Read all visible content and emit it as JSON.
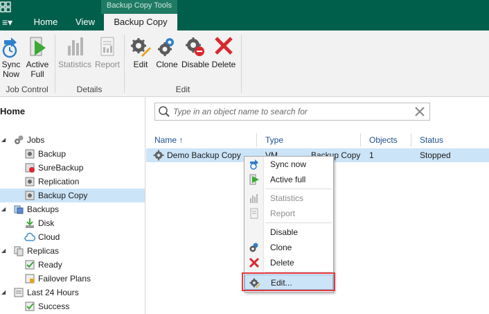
{
  "titlebar": {
    "context_group": "Backup Copy Tools"
  },
  "tabs": {
    "menu": "≡▾",
    "home": "Home",
    "view": "View",
    "backup_copy": "Backup Copy"
  },
  "ribbon": {
    "groups": {
      "job_control": "Job Control",
      "details": "Details",
      "edit": "Edit"
    },
    "buttons": {
      "sync_now": [
        "Sync",
        "Now"
      ],
      "active_full": [
        "Active",
        "Full"
      ],
      "statistics": "Statistics",
      "report": "Report",
      "edit": "Edit",
      "clone": "Clone",
      "disable": "Disable",
      "delete": "Delete"
    }
  },
  "nav": {
    "title": "Home",
    "items": [
      {
        "label": "Jobs",
        "level": 0,
        "icon": "jobs-gear-icon"
      },
      {
        "label": "Backup",
        "level": 1,
        "icon": "backup-job-icon"
      },
      {
        "label": "SureBackup",
        "level": 1,
        "icon": "surebackup-icon"
      },
      {
        "label": "Replication",
        "level": 1,
        "icon": "replication-icon"
      },
      {
        "label": "Backup Copy",
        "level": 1,
        "icon": "backup-copy-icon",
        "selected": true
      },
      {
        "label": "Backups",
        "level": 0,
        "icon": "backups-icon"
      },
      {
        "label": "Disk",
        "level": 1,
        "icon": "disk-icon"
      },
      {
        "label": "Cloud",
        "level": 1,
        "icon": "cloud-icon"
      },
      {
        "label": "Replicas",
        "level": 0,
        "icon": "replicas-icon"
      },
      {
        "label": "Ready",
        "level": 1,
        "icon": "ready-icon"
      },
      {
        "label": "Failover Plans",
        "level": 1,
        "icon": "failover-plans-icon"
      },
      {
        "label": "Last 24 Hours",
        "level": 0,
        "icon": "last-24-hours-icon"
      },
      {
        "label": "Success",
        "level": 1,
        "icon": "success-icon"
      }
    ]
  },
  "search": {
    "placeholder": "Type in an object name to search for"
  },
  "table": {
    "columns": {
      "name": "Name",
      "sort_indicator": "↑",
      "type": "Type",
      "objects": "Objects",
      "status": "Status"
    },
    "rows": [
      {
        "name": "Demo Backup Copy",
        "type_left": "VM",
        "type_right": "Backup Copy",
        "objects": "1",
        "status": "Stopped"
      }
    ]
  },
  "context_menu": {
    "items": {
      "sync_now": "Sync now",
      "active_full": "Active full",
      "statistics": "Statistics",
      "report": "Report",
      "disable": "Disable",
      "clone": "Clone",
      "delete": "Delete",
      "edit": "Edit..."
    }
  },
  "colors": {
    "brand": "#005f4b",
    "selection": "#cce4f7",
    "highlight": "#e0383e",
    "link": "#1d4f91"
  }
}
